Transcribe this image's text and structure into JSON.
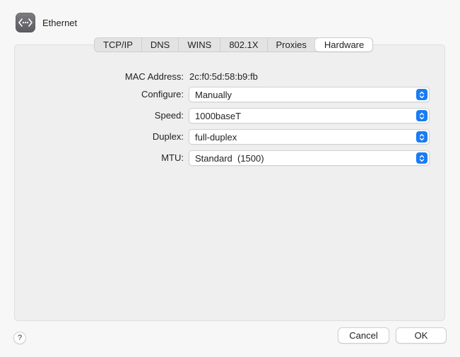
{
  "header": {
    "title": "Ethernet",
    "icon": "ethernet-icon"
  },
  "tabs": [
    {
      "label": "TCP/IP",
      "active": false
    },
    {
      "label": "DNS",
      "active": false
    },
    {
      "label": "WINS",
      "active": false
    },
    {
      "label": "802.1X",
      "active": false
    },
    {
      "label": "Proxies",
      "active": false
    },
    {
      "label": "Hardware",
      "active": true
    }
  ],
  "hardware": {
    "mac_label": "MAC Address:",
    "mac_value": "2c:f0:5d:58:b9:fb",
    "configure_label": "Configure:",
    "configure_value": "Manually",
    "speed_label": "Speed:",
    "speed_value": "1000baseT",
    "duplex_label": "Duplex:",
    "duplex_value": "full-duplex",
    "mtu_label": "MTU:",
    "mtu_value": "Standard  (1500)"
  },
  "footer": {
    "help_label": "?",
    "cancel_label": "Cancel",
    "ok_label": "OK"
  },
  "colors": {
    "accent": "#1a7cf5"
  }
}
